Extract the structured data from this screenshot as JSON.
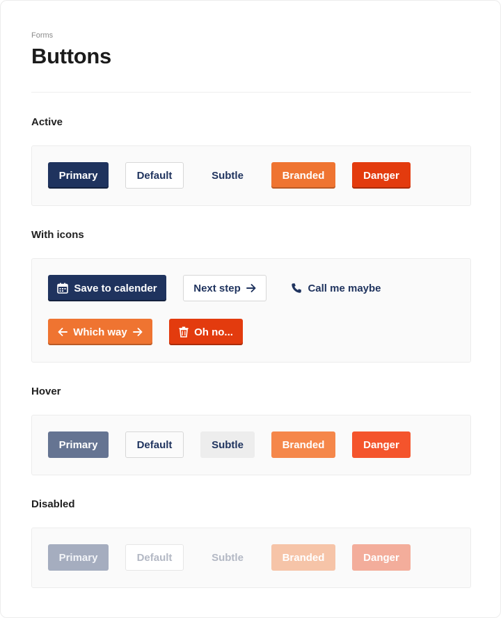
{
  "header": {
    "breadcrumb": "Forms",
    "title": "Buttons"
  },
  "sections": {
    "active": {
      "title": "Active",
      "buttons": {
        "primary": "Primary",
        "default": "Default",
        "subtle": "Subtle",
        "branded": "Branded",
        "danger": "Danger"
      }
    },
    "with_icons": {
      "title": "With icons",
      "buttons": {
        "save": {
          "label": "Save to calender",
          "icon": "calendar-icon"
        },
        "next": {
          "label": "Next step",
          "icon": "arrow-right-icon"
        },
        "call": {
          "label": "Call me maybe",
          "icon": "phone-icon"
        },
        "which": {
          "label": "Which way",
          "icons": [
            "arrow-left-icon",
            "arrow-right-icon"
          ]
        },
        "oh_no": {
          "label": "Oh no...",
          "icon": "trash-icon"
        }
      }
    },
    "hover": {
      "title": "Hover",
      "buttons": {
        "primary": "Primary",
        "default": "Default",
        "subtle": "Subtle",
        "branded": "Branded",
        "danger": "Danger"
      }
    },
    "disabled": {
      "title": "Disabled",
      "buttons": {
        "primary": "Primary",
        "default": "Default",
        "subtle": "Subtle",
        "branded": "Branded",
        "danger": "Danger"
      }
    }
  },
  "colors": {
    "primary": "#1f335e",
    "branded": "#ef7431",
    "danger": "#e33b0e",
    "panel_bg": "#fafafa"
  }
}
